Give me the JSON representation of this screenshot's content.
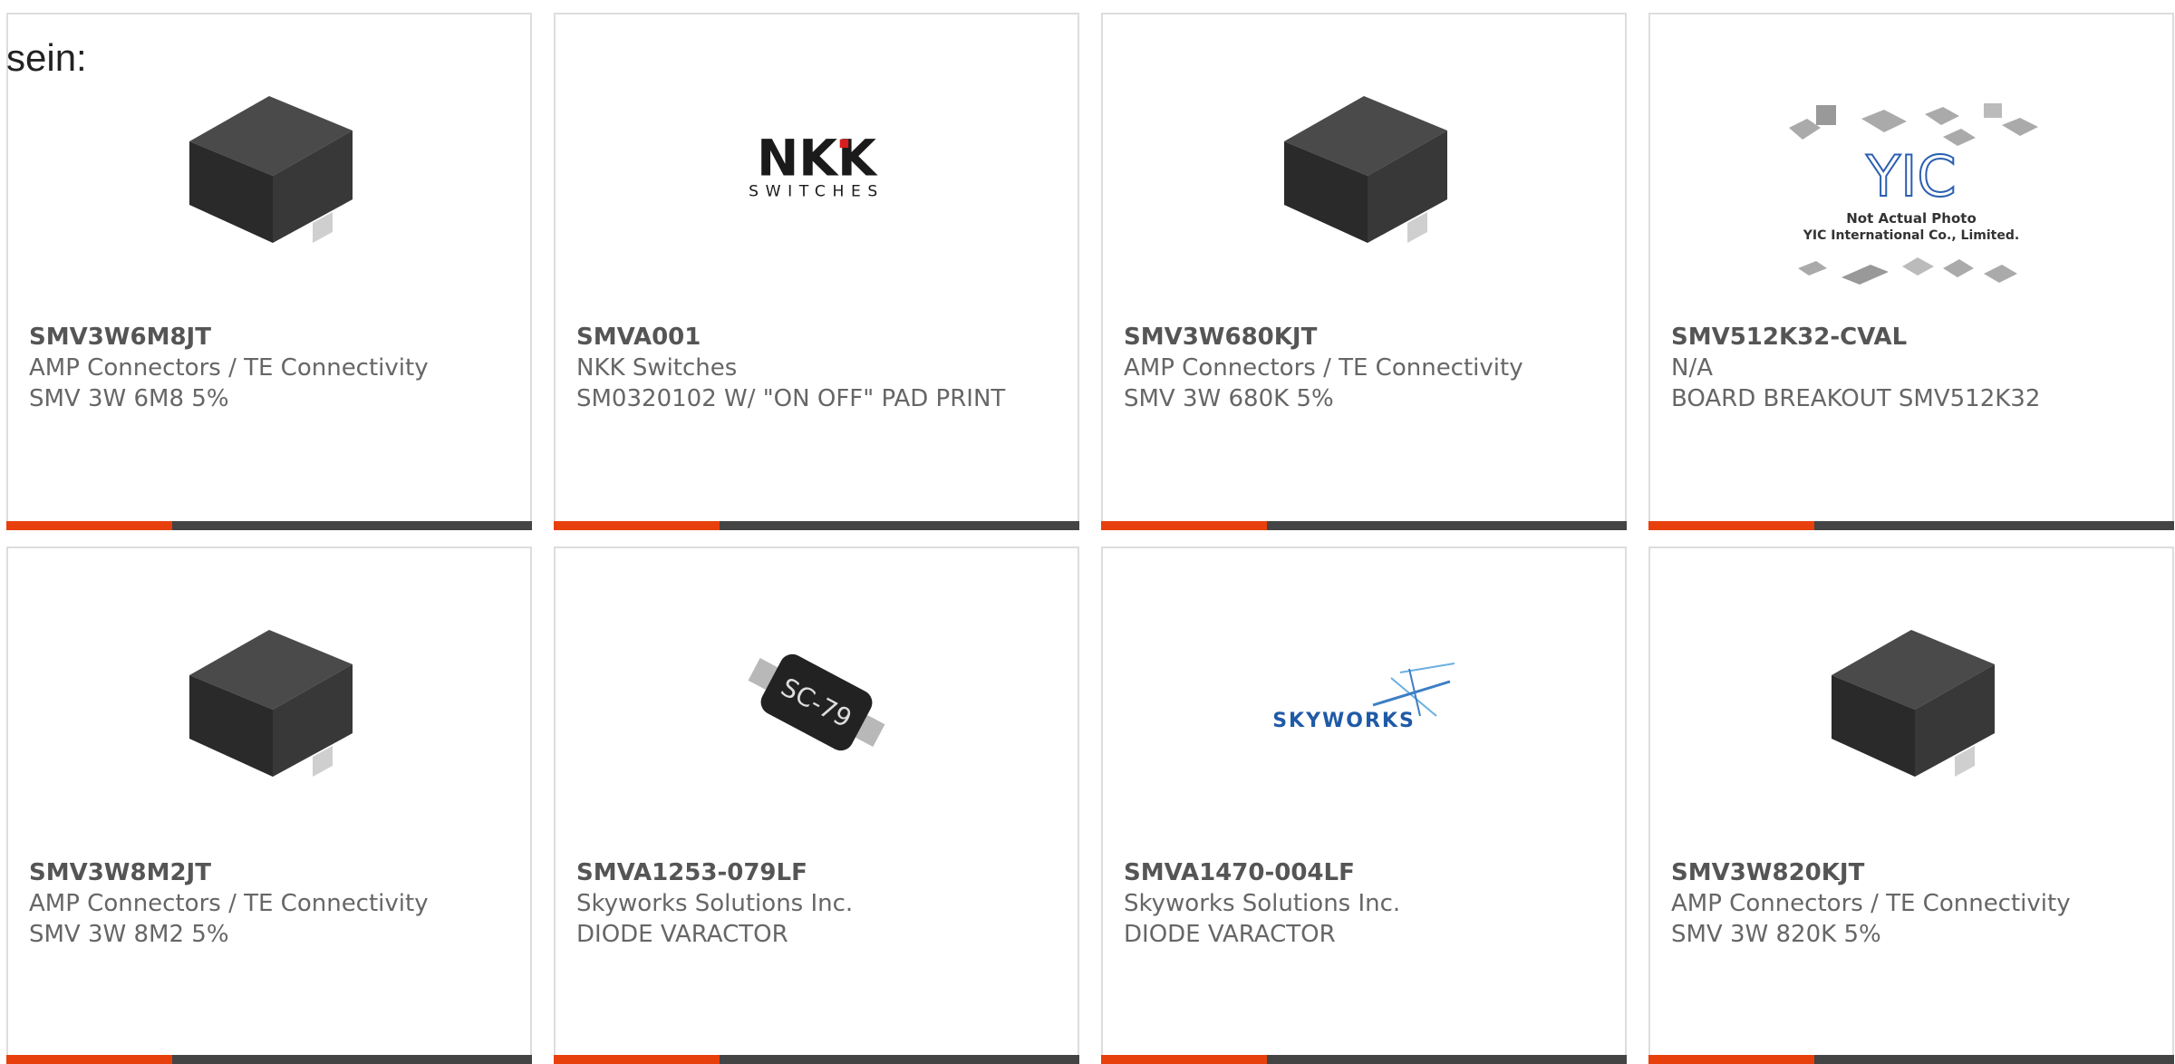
{
  "intro_text": "sein:",
  "colors": {
    "accent_orange": "#e8400c",
    "accent_dark": "#444444",
    "card_border": "#dddddd",
    "text_gray": "#666666"
  },
  "products": [
    {
      "part_number": "SMV3W6M8JT",
      "manufacturer": "AMP Connectors / TE Connectivity",
      "description": "SMV 3W 6M8 5%",
      "image": "black-smd-component-icon"
    },
    {
      "part_number": "SMVA001",
      "manufacturer": "NKK Switches",
      "description": "SM0320102 W/ \"ON OFF\" PAD PRINT",
      "image": "nkk-switches-logo",
      "logo_text": "NKK",
      "logo_subtext": "SWITCHES"
    },
    {
      "part_number": "SMV3W680KJT",
      "manufacturer": "AMP Connectors / TE Connectivity",
      "description": "SMV 3W 680K 5%",
      "image": "black-smd-component-icon"
    },
    {
      "part_number": "SMV512K32-CVAL",
      "manufacturer": "N/A",
      "description": "BOARD BREAKOUT SMV512K32",
      "image": "yic-not-actual-photo",
      "logo_text": "YIC",
      "caption_line1": "Not Actual Photo",
      "caption_line2": "YIC International Co., Limited."
    },
    {
      "part_number": "SMV3W8M2JT",
      "manufacturer": "AMP Connectors / TE Connectivity",
      "description": "SMV 3W 8M2 5%",
      "image": "black-smd-component-icon"
    },
    {
      "part_number": "SMVA1253-079LF",
      "manufacturer": "Skyworks Solutions Inc.",
      "description": "DIODE VARACTOR",
      "image": "sc-79-diode-photo",
      "chip_label": "SC-79"
    },
    {
      "part_number": "SMVA1470-004LF",
      "manufacturer": "Skyworks Solutions Inc.",
      "description": "DIODE VARACTOR",
      "image": "skyworks-logo",
      "logo_text": "SKYWORKS"
    },
    {
      "part_number": "SMV3W820KJT",
      "manufacturer": "AMP Connectors / TE Connectivity",
      "description": "SMV 3W 820K 5%",
      "image": "black-smd-component-icon"
    }
  ]
}
